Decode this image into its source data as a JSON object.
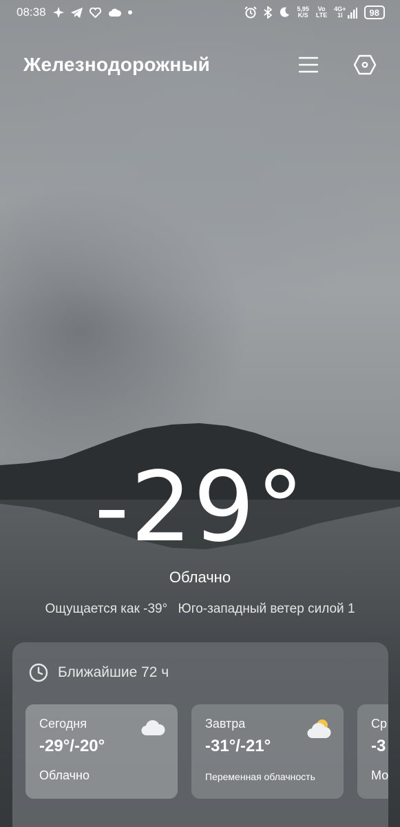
{
  "status": {
    "time": "08:38",
    "net_speed_value": "5,95",
    "net_speed_unit": "K/S",
    "volte_top": "Vo",
    "volte_bottom": "LTE",
    "network_top": "4G+",
    "network_bottom": "1l",
    "battery": "98"
  },
  "header": {
    "city": "Железнодорожный"
  },
  "current": {
    "temperature": "-29°",
    "condition": "Облачно",
    "feels_like": "Ощущается как -39°",
    "wind": "Юго-западный ветер силой 1"
  },
  "forecast": {
    "title": "Ближайшие 72 ч",
    "days": [
      {
        "day": "Сегодня",
        "temps": "-29°/-20°",
        "condition": "Облачно",
        "icon": "cloud-icon"
      },
      {
        "day": "Завтра",
        "temps": "-31°/-21°",
        "condition": "Переменная облачность",
        "icon": "partly-cloudy-icon"
      },
      {
        "day": "Ср",
        "temps": "-3",
        "condition": "Мо",
        "icon": ""
      }
    ]
  }
}
